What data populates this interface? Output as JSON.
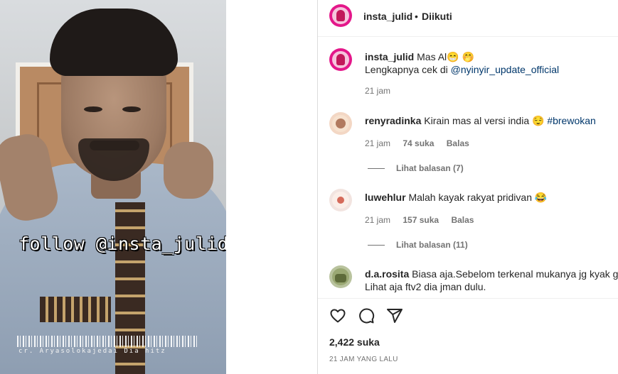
{
  "media": {
    "overlay_text": "follow @insta_julid",
    "credit_text": "cr. Aryasolokajedai Dia hitz"
  },
  "header": {
    "username": "insta_julid",
    "separator": "•",
    "follow_status": "Diikuti"
  },
  "caption": {
    "username": "insta_julid",
    "line1": "Mas Al😁 🤭",
    "line2_prefix": "Lengkapnya cek di ",
    "line2_link": "@nyinyir_update_official",
    "time": "21 jam"
  },
  "comments": [
    {
      "username": "renyradinka",
      "text": "Kirain mas al versi india 😌 ",
      "hashtag": "#brewokan",
      "time": "21 jam",
      "likes": "74 suka",
      "reply_label": "Balas",
      "view_replies": "Lihat balasan (7)"
    },
    {
      "username": "luwehlur",
      "text": "Malah kayak rakyat pridivan 😂",
      "time": "21 jam",
      "likes": "157 suka",
      "reply_label": "Balas",
      "view_replies": "Lihat balasan (11)"
    },
    {
      "username": "d.a.rosita",
      "text": "Biasa aja.Sebelom terkenal mukanya jg kyak gitu",
      "text_line2": "Lihat aja ftv2 dia jman dulu."
    }
  ],
  "actions": {
    "like_icon": "heart-icon",
    "comment_icon": "comment-icon",
    "share_icon": "share-icon",
    "likes_count": "2,422 suka",
    "time_ago": "21 JAM YANG LALU"
  },
  "colors": {
    "brand_avatar": "#e4178a",
    "link": "#00376b",
    "muted": "#737373"
  }
}
